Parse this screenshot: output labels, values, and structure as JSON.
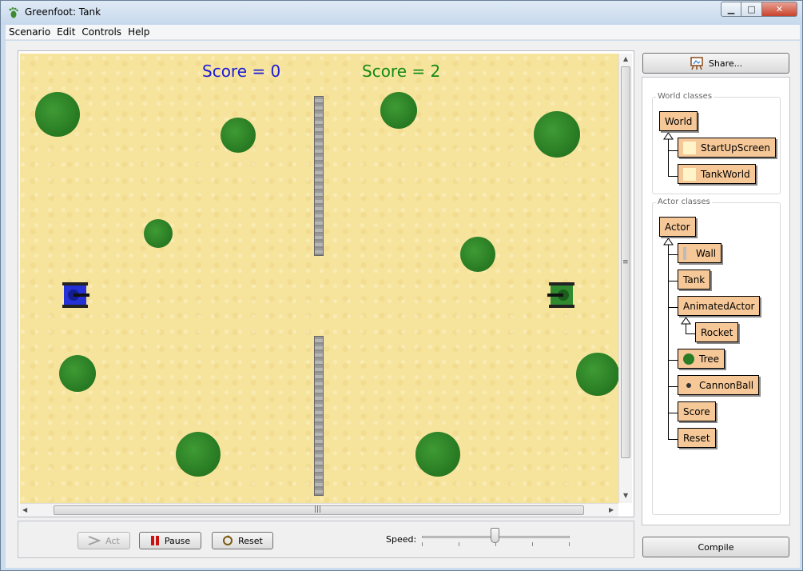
{
  "window": {
    "title": "Greenfoot: Tank",
    "icon": "greenfoot-footprint-icon",
    "controls": {
      "minimize": "▁",
      "maximize": "□",
      "close": "✕"
    }
  },
  "menu": [
    "Scenario",
    "Edit",
    "Controls",
    "Help"
  ],
  "world": {
    "score1": "Score = 0",
    "score2": "Score = 2",
    "colors": {
      "sand": "#f7e49c",
      "score1": "#1a1ad8",
      "score2": "#138a13",
      "tree": "#2a7d24"
    }
  },
  "controls": {
    "act": "Act",
    "pause": "Pause",
    "reset": "Reset",
    "speed_label": "Speed:",
    "speed": 0.5
  },
  "side": {
    "share": "Share...",
    "world_classes_title": "World classes",
    "world_classes": [
      "World",
      "StartUpScreen",
      "TankWorld"
    ],
    "actor_classes_title": "Actor classes",
    "actor_classes": [
      "Actor",
      "Wall",
      "Tank",
      "AnimatedActor",
      "Rocket",
      "Tree",
      "CannonBall",
      "Score",
      "Reset"
    ],
    "compile": "Compile"
  }
}
